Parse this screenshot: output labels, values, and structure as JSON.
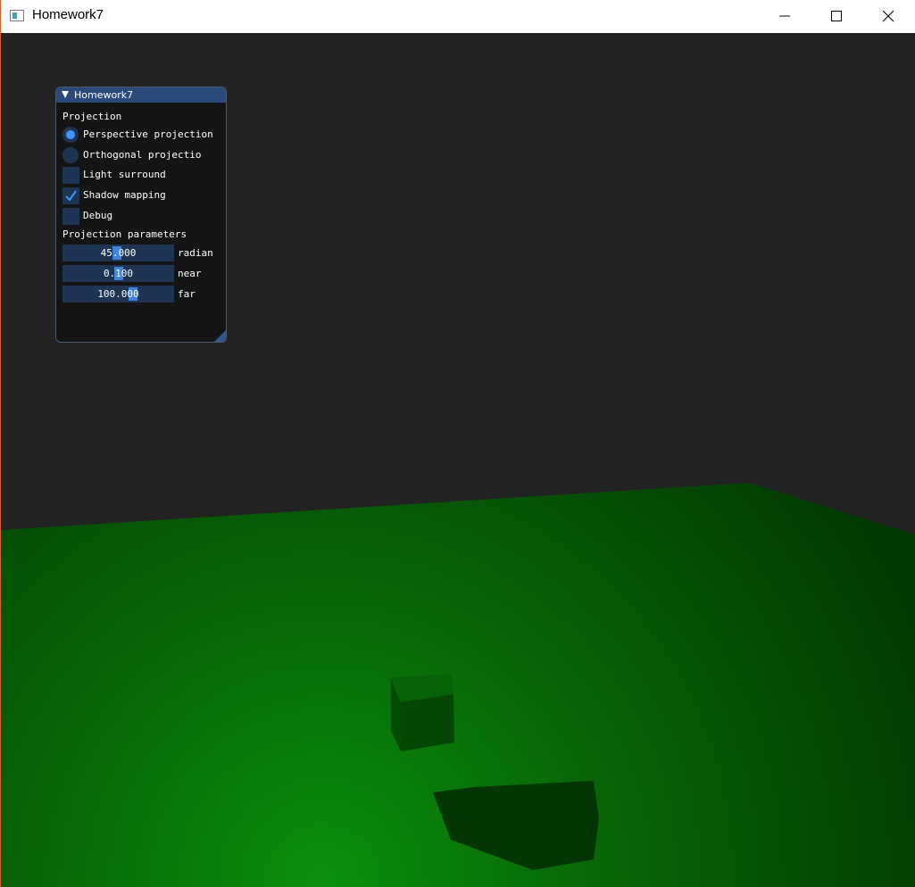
{
  "window": {
    "title": "Homework7",
    "icons": {
      "app": "app-window-icon",
      "minimize": "minimize-icon",
      "maximize": "maximize-icon",
      "close": "close-icon"
    }
  },
  "panel": {
    "title": "Homework7",
    "section_projection": "Projection",
    "radios": [
      {
        "label": "Perspective projection",
        "selected": true
      },
      {
        "label": "Orthogonal projectio",
        "selected": false
      }
    ],
    "checkboxes": [
      {
        "label": "Light surround",
        "checked": false
      },
      {
        "label": "Shadow mapping",
        "checked": true
      },
      {
        "label": "Debug",
        "checked": false
      }
    ],
    "section_params": "Projection parameters",
    "sliders": [
      {
        "value": "45.000",
        "label": "radian"
      },
      {
        "value": "0.100",
        "label": "near"
      },
      {
        "value": "100.000",
        "label": "far"
      }
    ]
  },
  "colors": {
    "background": "#222222",
    "ground": "#0b6d0b",
    "accent": "#4296fa",
    "title_bar_active": "#294a7a"
  }
}
